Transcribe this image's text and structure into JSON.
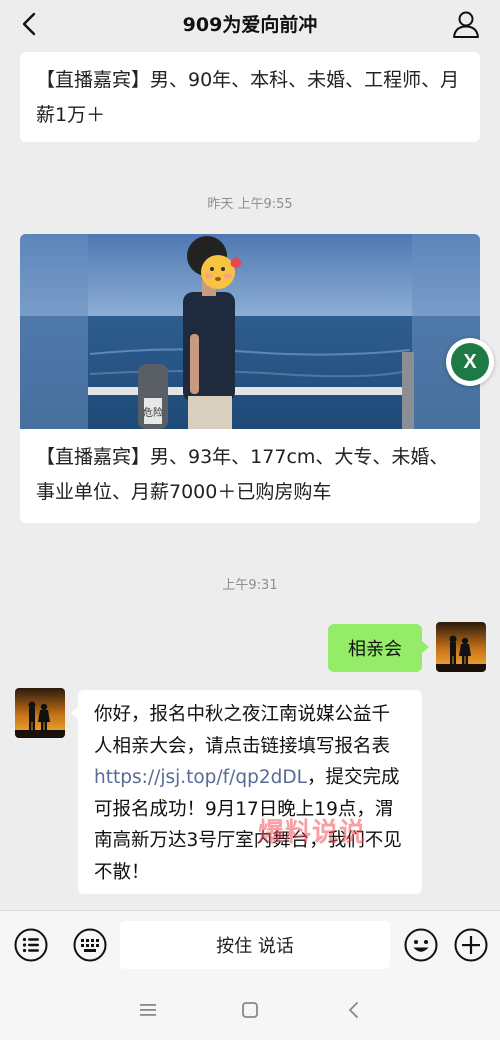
{
  "header": {
    "title": "909为爱向前冲"
  },
  "messages": {
    "card1_text": "【直播嘉宾】男、90年、本科、未婚、工程师、月薪1万＋",
    "time1": "昨天 上午9:55",
    "card2_text": "【直播嘉宾】男、93年、177cm、大专、未婚、事业单位、月薪7000＋已购房购车",
    "photo_sign": "危险",
    "time2": "上午9:31",
    "sent_text": "相亲会",
    "reply_before_link": "你好，报名中秋之夜江南说媒公益千人相亲大会，请点击链接填写报名表 ",
    "reply_link": "https://jsj.top/f/qp2dDL",
    "reply_after_link": "，提交完成可报名成功！9月17日晚上19点，渭南高新万达3号厅室内舞台，我们不见不散！"
  },
  "floating_button": {
    "label": "X"
  },
  "watermark": "爆料说说",
  "input_bar": {
    "talk_label": "按住 说话"
  },
  "icons": {
    "back": "chevron-left-icon",
    "profile": "person-icon",
    "voice": "voice-list-icon",
    "keyboard": "keyboard-icon",
    "emoji": "emoji-icon",
    "add": "plus-circle-icon"
  },
  "colors": {
    "background": "#ededed",
    "sent_bubble": "#95ec69",
    "link": "#576b95",
    "floating_button": "#1e7a45"
  }
}
